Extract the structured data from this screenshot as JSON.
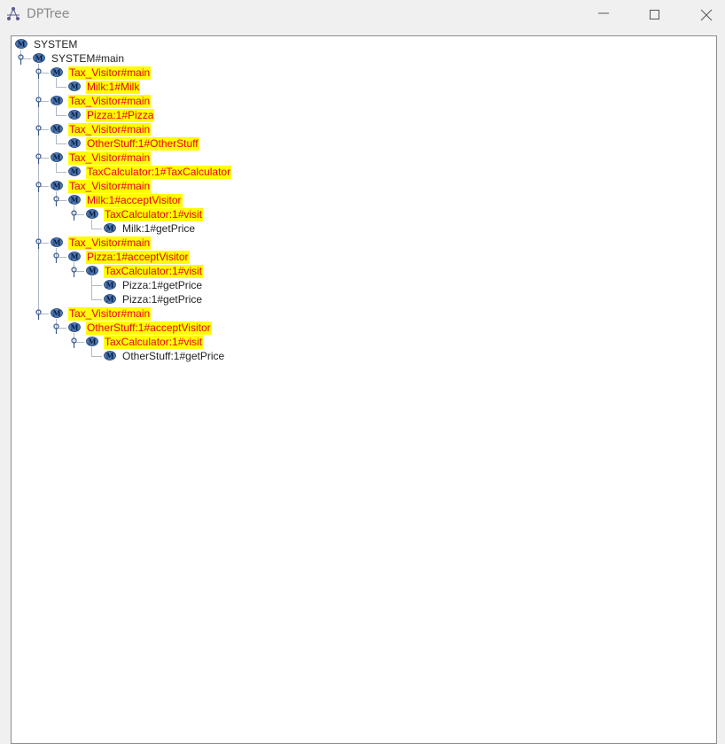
{
  "window": {
    "title": "DPTree"
  },
  "colors": {
    "highlight_bg": "#ffff00",
    "highlight_text": "#e6001a",
    "normal_text": "#222222",
    "icon_fill": "#4a78b5"
  },
  "tree": {
    "nodes": [
      {
        "label": "SYSTEM",
        "depth": 0,
        "highlight": false
      },
      {
        "label": "SYSTEM#main",
        "depth": 1,
        "highlight": false
      },
      {
        "label": "Tax_Visitor#main",
        "depth": 2,
        "highlight": true
      },
      {
        "label": "Milk:1#Milk",
        "depth": 3,
        "highlight": true
      },
      {
        "label": "Tax_Visitor#main",
        "depth": 2,
        "highlight": true
      },
      {
        "label": "Pizza:1#Pizza",
        "depth": 3,
        "highlight": true
      },
      {
        "label": "Tax_Visitor#main",
        "depth": 2,
        "highlight": true
      },
      {
        "label": "OtherStuff:1#OtherStuff",
        "depth": 3,
        "highlight": true
      },
      {
        "label": "Tax_Visitor#main",
        "depth": 2,
        "highlight": true
      },
      {
        "label": "TaxCalculator:1#TaxCalculator",
        "depth": 3,
        "highlight": true
      },
      {
        "label": "Tax_Visitor#main",
        "depth": 2,
        "highlight": true
      },
      {
        "label": "Milk:1#acceptVisitor",
        "depth": 3,
        "highlight": true
      },
      {
        "label": "TaxCalculator:1#visit",
        "depth": 4,
        "highlight": true
      },
      {
        "label": "Milk:1#getPrice",
        "depth": 5,
        "highlight": false
      },
      {
        "label": "Tax_Visitor#main",
        "depth": 2,
        "highlight": true
      },
      {
        "label": "Pizza:1#acceptVisitor",
        "depth": 3,
        "highlight": true
      },
      {
        "label": "TaxCalculator:1#visit",
        "depth": 4,
        "highlight": true
      },
      {
        "label": "Pizza:1#getPrice",
        "depth": 5,
        "highlight": false
      },
      {
        "label": "Pizza:1#getPrice",
        "depth": 5,
        "highlight": false
      },
      {
        "label": "Tax_Visitor#main",
        "depth": 2,
        "highlight": true
      },
      {
        "label": "OtherStuff:1#acceptVisitor",
        "depth": 3,
        "highlight": true
      },
      {
        "label": "TaxCalculator:1#visit",
        "depth": 4,
        "highlight": true
      },
      {
        "label": "OtherStuff:1#getPrice",
        "depth": 5,
        "highlight": false
      }
    ]
  }
}
